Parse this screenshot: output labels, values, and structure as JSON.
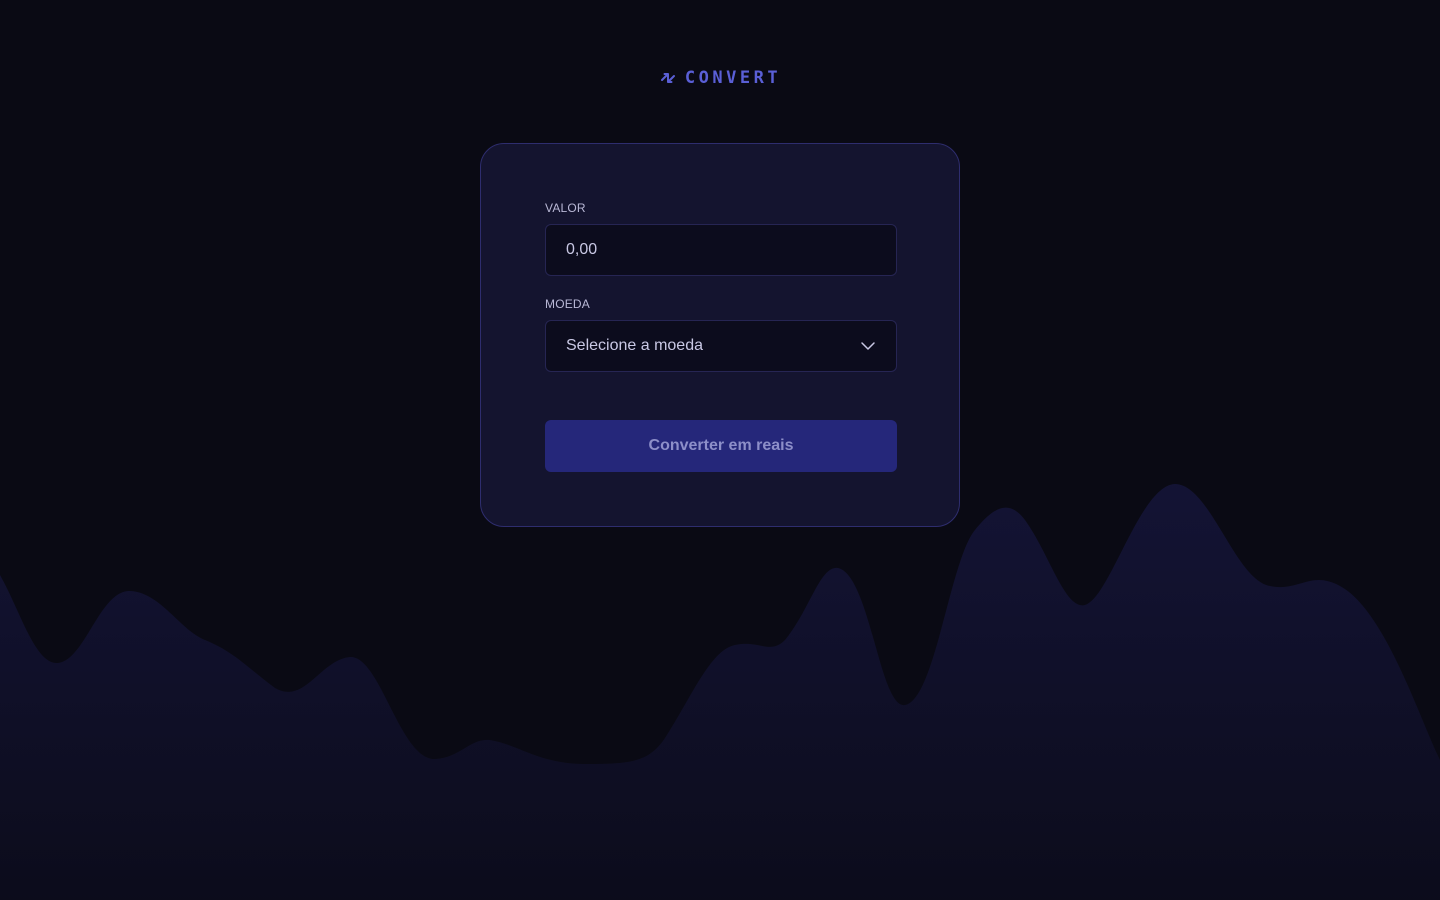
{
  "brand": {
    "name": "CONVERT",
    "icon": "exchange-arrows-icon",
    "color": "#5a5fd6"
  },
  "form": {
    "amount": {
      "label": "VALOR",
      "value": "0,00"
    },
    "currency": {
      "label": "MOEDA",
      "selected": "Selecione a moeda",
      "icon": "chevron-down-icon"
    },
    "submit_label": "Converter em reais"
  },
  "colors": {
    "background": "#0a0a14",
    "card": "#14142f",
    "card_border": "#2e2d6e",
    "button": "#25277a",
    "wave": "#12122b"
  }
}
